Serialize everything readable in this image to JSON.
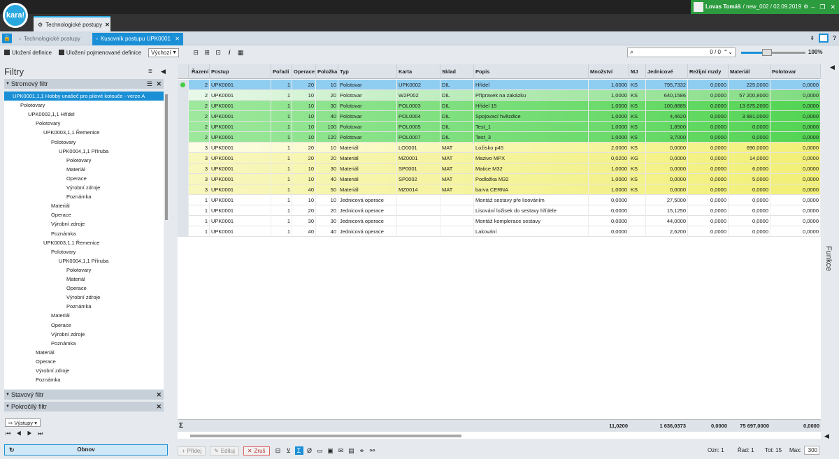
{
  "app": {
    "logo": "kara!",
    "user": "Lovas Tomáš",
    "session": "/ new_002 / 02.09.2019"
  },
  "tabs": {
    "main": "Technologické postupy",
    "sub1": "Technologické postupy",
    "sub2": "Kusovník postupu UPK0001"
  },
  "toolbar": {
    "save_def": "Uložení definice",
    "save_named_def": "Uložení pojmenované definice",
    "preset": "Výchozí",
    "search_count": "0 / 0",
    "zoom": "100%",
    "zoom_level": 0.4
  },
  "left": {
    "title": "Filtry",
    "tree_filter": "Stromový filtr",
    "state_filter": "Stavový filtr",
    "adv_filter": "Pokročilý filtr",
    "outputs": "Výstupy",
    "refresh": "Obnov",
    "nav": "⏮ ◀ ▶ ⏭"
  },
  "tree": [
    {
      "label": "UPK0001,1,1 Hobby unašeč pro pilové kotouče - verze A",
      "lvl": 0,
      "sel": true
    },
    {
      "label": "Polotovary",
      "lvl": 1
    },
    {
      "label": "UPK0002,1,1 Hřídel",
      "lvl": 2
    },
    {
      "label": "Polotovary",
      "lvl": 3
    },
    {
      "label": "UPK0003,1,1 Řemenice",
      "lvl": 4
    },
    {
      "label": "Polotovary",
      "lvl": 5
    },
    {
      "label": "UPK0004,1,1 Příruba",
      "lvl": 6
    },
    {
      "label": "Polotovary",
      "lvl": 7
    },
    {
      "label": "Materiál",
      "lvl": 7
    },
    {
      "label": "Operace",
      "lvl": 7
    },
    {
      "label": "Výrobní zdroje",
      "lvl": 7
    },
    {
      "label": "Poznámka",
      "lvl": 7
    },
    {
      "label": "Materiál",
      "lvl": 5
    },
    {
      "label": "Operace",
      "lvl": 5
    },
    {
      "label": "Výrobní zdroje",
      "lvl": 5
    },
    {
      "label": "Poznámka",
      "lvl": 5
    },
    {
      "label": "UPK0003,1,1 Řemenice",
      "lvl": 4
    },
    {
      "label": "Polotovary",
      "lvl": 5
    },
    {
      "label": "UPK0004,1,1 Příruba",
      "lvl": 6
    },
    {
      "label": "Polotovary",
      "lvl": 7
    },
    {
      "label": "Materiál",
      "lvl": 7
    },
    {
      "label": "Operace",
      "lvl": 7
    },
    {
      "label": "Výrobní zdroje",
      "lvl": 7
    },
    {
      "label": "Poznámka",
      "lvl": 7
    },
    {
      "label": "Materiál",
      "lvl": 5
    },
    {
      "label": "Operace",
      "lvl": 5
    },
    {
      "label": "Výrobní zdroje",
      "lvl": 5
    },
    {
      "label": "Poznámka",
      "lvl": 5
    },
    {
      "label": "Materiál",
      "lvl": 3
    },
    {
      "label": "Operace",
      "lvl": 3
    },
    {
      "label": "Výrobní zdroje",
      "lvl": 3
    },
    {
      "label": "Poznámka",
      "lvl": 3
    }
  ],
  "columns": [
    "Řazení",
    "Postup",
    "Pořadí",
    "Operace",
    "Položka",
    "Typ",
    "Karta",
    "Sklad",
    "Popis",
    "Množství",
    "MJ",
    "Jednicové mzdy",
    "Režijní mzdy",
    "Materiál",
    "Polotovar"
  ],
  "rows": [
    {
      "c": "blu",
      "v": [
        "2",
        "UPK0001",
        "1",
        "20",
        "10",
        "Polotovar",
        "UPK0002",
        "DIL",
        "Hřídel",
        "1,0000",
        "KS",
        "795,7332",
        "0,0000",
        "225,0000",
        "0,0000"
      ]
    },
    {
      "c": "g2",
      "v": [
        "2",
        "UPK0001",
        "1",
        "10",
        "20",
        "Polotovar",
        "W2P002",
        "DIL",
        "Přípravek na zakázku",
        "1,0000",
        "KS",
        "640,1586",
        "0,0000",
        "57 200,8000",
        "0,0000"
      ]
    },
    {
      "c": "g1",
      "v": [
        "2",
        "UPK0001",
        "1",
        "10",
        "30",
        "Polotovar",
        "POL0003",
        "DIL",
        "Hřídel 15",
        "1,0000",
        "KS",
        "100,8885",
        "0,0000",
        "13 675,2000",
        "0,0000"
      ]
    },
    {
      "c": "g1",
      "v": [
        "2",
        "UPK0001",
        "1",
        "10",
        "40",
        "Polotovar",
        "POL0004",
        "DIL",
        "Spojovací hvězdice",
        "1,0000",
        "KS",
        "4,4620",
        "0,0000",
        "3 881,0000",
        "0,0000"
      ]
    },
    {
      "c": "g1",
      "v": [
        "2",
        "UPK0001",
        "1",
        "10",
        "100",
        "Polotovar",
        "POL0005",
        "DIL",
        "Test_1",
        "1,0000",
        "KS",
        "1,8500",
        "0,0000",
        "0,0000",
        "0,0000"
      ]
    },
    {
      "c": "g1",
      "v": [
        "2",
        "UPK0001",
        "1",
        "10",
        "120",
        "Polotovar",
        "POL0007",
        "DIL",
        "Test_3",
        "1,0000",
        "KS",
        "3,7000",
        "0,0000",
        "0,0000",
        "0,0000"
      ]
    },
    {
      "c": "y2",
      "v": [
        "3",
        "UPK0001",
        "1",
        "20",
        "10",
        "Materiál",
        "LO0001",
        "MAT",
        "Ložisko p45",
        "2,0000",
        "KS",
        "0,0000",
        "0,0000",
        "690,0000",
        "0,0000"
      ]
    },
    {
      "c": "y1",
      "v": [
        "3",
        "UPK0001",
        "1",
        "20",
        "20",
        "Materiál",
        "MZ0001",
        "MAT",
        "Mazivo MPX",
        "0,0200",
        "KG",
        "0,0000",
        "0,0000",
        "14,0000",
        "0,0000"
      ]
    },
    {
      "c": "y1",
      "v": [
        "3",
        "UPK0001",
        "1",
        "10",
        "30",
        "Materiál",
        "SP0001",
        "MAT",
        "Matice M32",
        "1,0000",
        "KS",
        "0,0000",
        "0,0000",
        "6,0000",
        "0,0000"
      ]
    },
    {
      "c": "y1",
      "v": [
        "3",
        "UPK0001",
        "1",
        "10",
        "40",
        "Materiál",
        "SP0002",
        "MAT",
        "Podložka M32",
        "1,0000",
        "KS",
        "0,0000",
        "0,0000",
        "5,0000",
        "0,0000"
      ]
    },
    {
      "c": "y1",
      "v": [
        "3",
        "UPK0001",
        "1",
        "40",
        "50",
        "Materiál",
        "MZ0014",
        "MAT",
        "barva CERNA",
        "1,0000",
        "KS",
        "0,0000",
        "0,0000",
        "0,0000",
        "0,0000"
      ]
    },
    {
      "c": "w",
      "v": [
        "1",
        "UPK0001",
        "1",
        "10",
        "10",
        "Jednicová operace",
        "",
        "",
        "Montáž sestavy pře lisováním",
        "0,0000",
        "",
        "27,5000",
        "0,0000",
        "0,0000",
        "0,0000"
      ]
    },
    {
      "c": "w",
      "v": [
        "1",
        "UPK0001",
        "1",
        "20",
        "20",
        "Jednicová operace",
        "",
        "",
        "Lisování ložisek do sestavy hřídele",
        "0,0000",
        "",
        "15,1250",
        "0,0000",
        "0,0000",
        "0,0000"
      ]
    },
    {
      "c": "w",
      "v": [
        "1",
        "UPK0001",
        "1",
        "30",
        "30",
        "Jednicová operace",
        "",
        "",
        "Montáž komplerace sestavy",
        "0,0000",
        "",
        "44,0000",
        "0,0000",
        "0,0000",
        "0,0000"
      ]
    },
    {
      "c": "w",
      "v": [
        "1",
        "UPK0001",
        "1",
        "40",
        "40",
        "Jednicová operace",
        "",
        "",
        "Lakování",
        "0,0000",
        "",
        "2,6200",
        "0,0000",
        "0,0000",
        "0,0000"
      ]
    }
  ],
  "sums": {
    "sigma": "Σ",
    "mnozstvi": "11,0200",
    "jednicove": "1 636,0373",
    "rezijni": "0,0000",
    "material": "75 697,0000",
    "polotovar": "0,0000"
  },
  "bottom": {
    "add": "Přidej",
    "edit": "Edituj",
    "cancel": "Zruš",
    "ozn_label": "Ozn:",
    "ozn": "1",
    "rad_label": "Řad:",
    "rad": "1",
    "tot_label": "Tot:",
    "tot": "15",
    "max_label": "Max:",
    "max": "300"
  },
  "right": {
    "funkce": "Funkce"
  }
}
